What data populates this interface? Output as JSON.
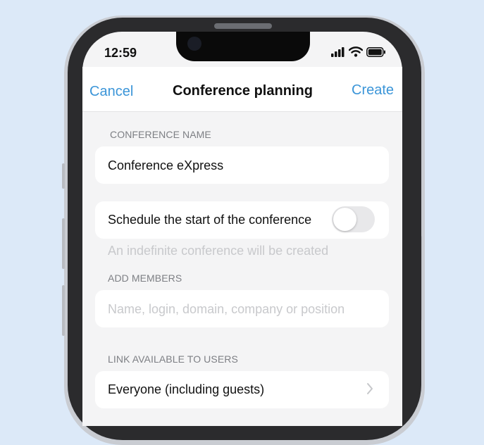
{
  "status_bar": {
    "time": "12:59"
  },
  "nav": {
    "cancel_label": "Cancel",
    "title": "Conference planning",
    "create_label": "Create"
  },
  "conference_name": {
    "section_label": "CONFERENCE NAME",
    "value": "Conference eXpress"
  },
  "schedule": {
    "label": "Schedule the start of the conference",
    "toggle_on": false,
    "hint": "An indefinite conference will be created"
  },
  "members": {
    "section_label": "ADD MEMBERS",
    "placeholder": "Name, login, domain, company or position"
  },
  "link": {
    "section_label": "LINK AVAILABLE TO USERS",
    "value": "Everyone (including guests)"
  },
  "colors": {
    "accent": "#3b95d8",
    "background": "#dce9f8",
    "screen": "#f4f4f5"
  }
}
